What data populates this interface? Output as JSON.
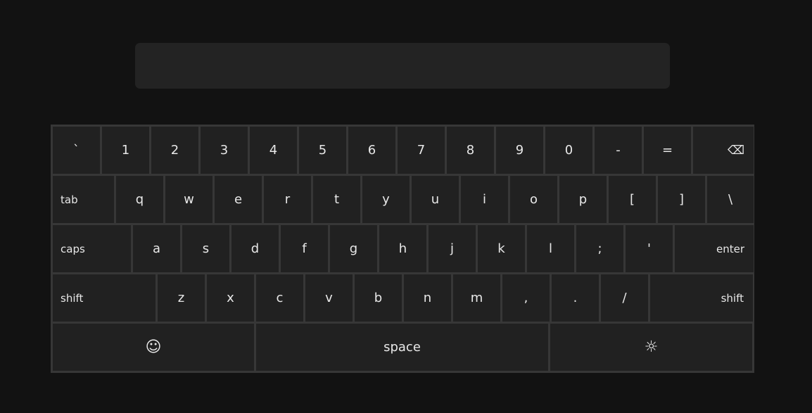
{
  "input": {
    "value": ""
  },
  "rows": [
    [
      {
        "label": "`",
        "name": "key-backtick"
      },
      {
        "label": "1",
        "name": "key-1"
      },
      {
        "label": "2",
        "name": "key-2"
      },
      {
        "label": "3",
        "name": "key-3"
      },
      {
        "label": "4",
        "name": "key-4"
      },
      {
        "label": "5",
        "name": "key-5"
      },
      {
        "label": "6",
        "name": "key-6"
      },
      {
        "label": "7",
        "name": "key-7"
      },
      {
        "label": "8",
        "name": "key-8"
      },
      {
        "label": "9",
        "name": "key-9"
      },
      {
        "label": "0",
        "name": "key-0"
      },
      {
        "label": "-",
        "name": "key-minus"
      },
      {
        "label": "=",
        "name": "key-equals"
      },
      {
        "label": "⌫",
        "name": "backspace-icon"
      }
    ],
    [
      {
        "label": "tab",
        "name": "key-tab"
      },
      {
        "label": "q",
        "name": "key-q"
      },
      {
        "label": "w",
        "name": "key-w"
      },
      {
        "label": "e",
        "name": "key-e"
      },
      {
        "label": "r",
        "name": "key-r"
      },
      {
        "label": "t",
        "name": "key-t"
      },
      {
        "label": "y",
        "name": "key-y"
      },
      {
        "label": "u",
        "name": "key-u"
      },
      {
        "label": "i",
        "name": "key-i"
      },
      {
        "label": "o",
        "name": "key-o"
      },
      {
        "label": "p",
        "name": "key-p"
      },
      {
        "label": "[",
        "name": "key-left-bracket"
      },
      {
        "label": "]",
        "name": "key-right-bracket"
      },
      {
        "label": "\\",
        "name": "key-backslash"
      }
    ],
    [
      {
        "label": "caps",
        "name": "key-caps"
      },
      {
        "label": "a",
        "name": "key-a"
      },
      {
        "label": "s",
        "name": "key-s"
      },
      {
        "label": "d",
        "name": "key-d"
      },
      {
        "label": "f",
        "name": "key-f"
      },
      {
        "label": "g",
        "name": "key-g"
      },
      {
        "label": "h",
        "name": "key-h"
      },
      {
        "label": "j",
        "name": "key-j"
      },
      {
        "label": "k",
        "name": "key-k"
      },
      {
        "label": "l",
        "name": "key-l"
      },
      {
        "label": ";",
        "name": "key-semicolon"
      },
      {
        "label": "'",
        "name": "key-quote"
      },
      {
        "label": "enter",
        "name": "key-enter"
      }
    ],
    [
      {
        "label": "shift",
        "name": "key-shift-left"
      },
      {
        "label": "z",
        "name": "key-z"
      },
      {
        "label": "x",
        "name": "key-x"
      },
      {
        "label": "c",
        "name": "key-c"
      },
      {
        "label": "v",
        "name": "key-v"
      },
      {
        "label": "b",
        "name": "key-b"
      },
      {
        "label": "n",
        "name": "key-n"
      },
      {
        "label": "m",
        "name": "key-m"
      },
      {
        "label": ",",
        "name": "key-comma"
      },
      {
        "label": ".",
        "name": "key-period"
      },
      {
        "label": "/",
        "name": "key-slash"
      },
      {
        "label": "shift",
        "name": "key-shift-right"
      }
    ],
    [
      {
        "label": "☺",
        "name": "emoji-icon"
      },
      {
        "label": "space",
        "name": "key-space"
      },
      {
        "label": "☼",
        "name": "brightness-icon"
      }
    ]
  ]
}
